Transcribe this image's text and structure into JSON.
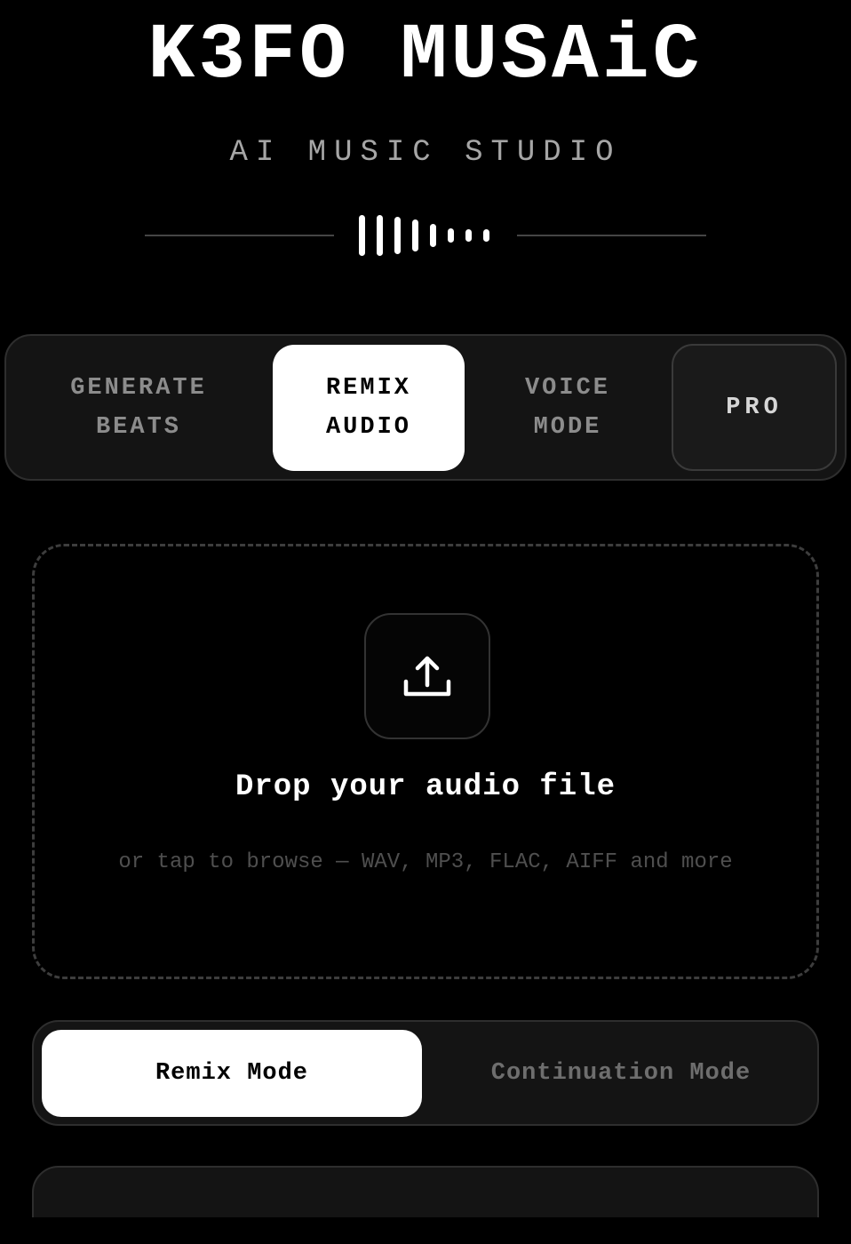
{
  "header": {
    "title": "K3FO MUSAiC",
    "subtitle": "AI MUSIC STUDIO",
    "waveform_icon": "waveform-icon"
  },
  "tabs": [
    {
      "line1": "GENERATE",
      "line2": "BEATS",
      "active": false
    },
    {
      "line1": "REMIX",
      "line2": "AUDIO",
      "active": true
    },
    {
      "line1": "VOICE",
      "line2": "MODE",
      "active": false
    },
    {
      "line1": "PRO",
      "line2": "",
      "active": false
    }
  ],
  "dropzone": {
    "icon": "upload-icon",
    "title": "Drop your audio file",
    "hint": "or tap to browse — WAV, MP3, FLAC, AIFF and more"
  },
  "modes": [
    {
      "label": "Remix Mode",
      "active": true
    },
    {
      "label": "Continuation Mode",
      "active": false
    }
  ],
  "colors": {
    "background": "#000000",
    "accent": "#ffffff",
    "panel": "#141414",
    "muted_text": "#8c8c8c"
  }
}
